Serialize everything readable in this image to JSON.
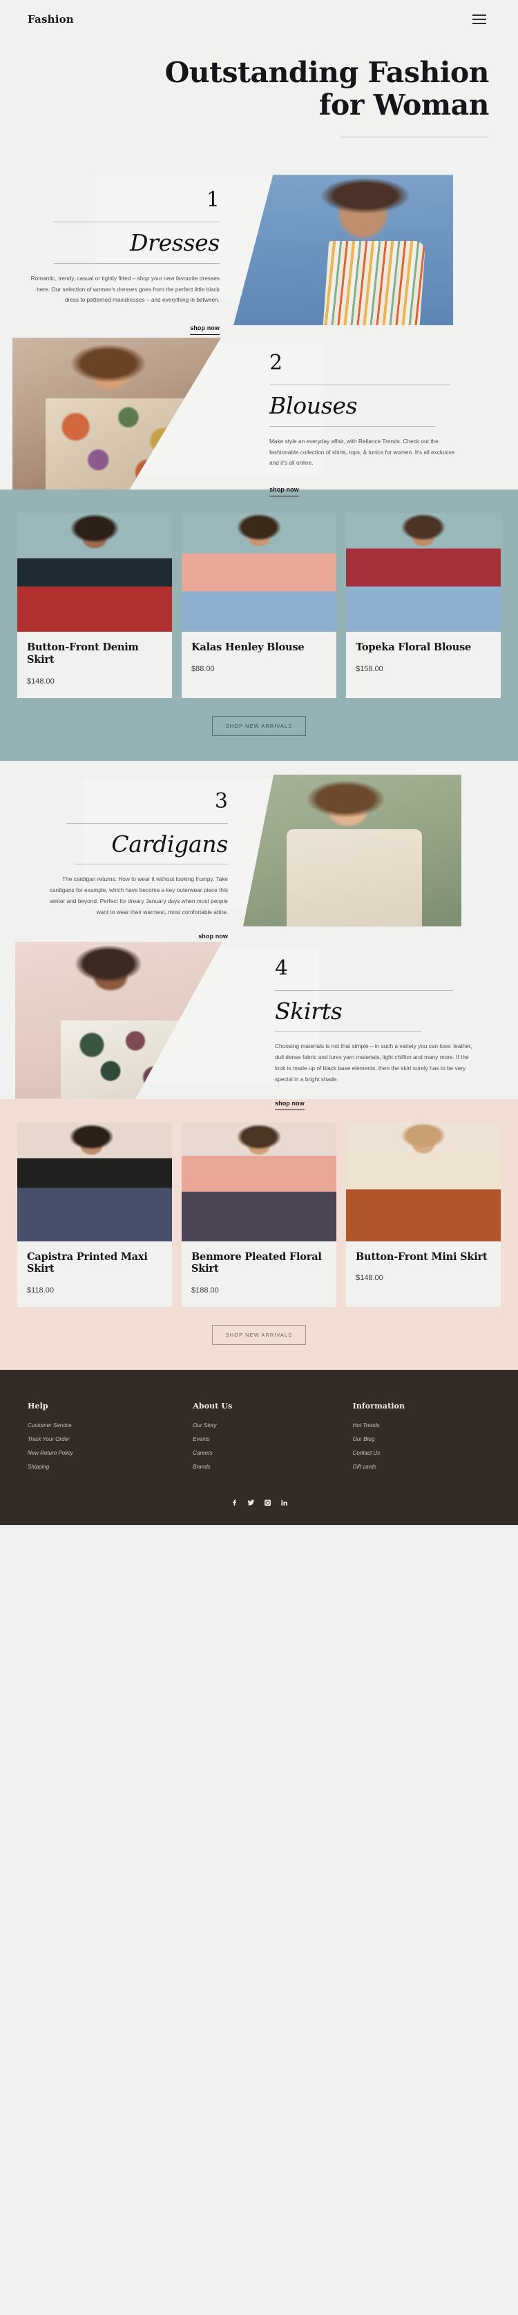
{
  "header": {
    "logo": "Fashion",
    "menu_icon": "hamburger-menu-icon"
  },
  "hero": {
    "title_line1": "Outstanding Fashion",
    "title_line2": "for Woman"
  },
  "sections": [
    {
      "number": "1",
      "title": "Dresses",
      "body": "Romantic, trendy, casual or tightly fitted – shop your new favourite dresses here. Our selection of women's dresses goes from the perfect little black dress to patterned maxidresses – and everything in between.",
      "cta": "shop now",
      "align": "right"
    },
    {
      "number": "2",
      "title": "Blouses",
      "body": "Make style an everyday affair, with Reliance Trends. Check out the fashionable collection of shirts, tops, & tunics for women. It's all exclusive and it's all online.",
      "cta": "shop now",
      "align": "left"
    },
    {
      "number": "3",
      "title": "Cardigans",
      "body": "The cardigan returns: How to wear it without looking frumpy. Take cardigans for example, which have become a key outerwear piece this winter and beyond. Perfect for dreary January days when most people want to wear their warmest, most comfortable attire.",
      "cta": "shop now",
      "align": "right"
    },
    {
      "number": "4",
      "title": "Skirts",
      "body": "Choosing materials is not that simple – in such a variety you can lose: leather, dull dense fabric and lurex yarn materials, light chiffon and many more. If the look is made up of black base elements, then the skirt surely has to be very special in a bright shade.",
      "cta": "shop now",
      "align": "left"
    }
  ],
  "band_teal": {
    "background_color": "#95b3b5",
    "products": [
      {
        "name": "Button-Front Denim Skirt",
        "price": "$148.00"
      },
      {
        "name": "Kalas Henley Blouse",
        "price": "$88.00"
      },
      {
        "name": "Topeka Floral Blouse",
        "price": "$158.00"
      }
    ],
    "cta": "SHOP NEW ARRIVALS"
  },
  "band_pink": {
    "background_color": "#f2ded4",
    "products": [
      {
        "name": "Capistra Printed Maxi Skirt",
        "price": "$118.00"
      },
      {
        "name": "Benmore Pleated Floral Skirt",
        "price": "$188.00"
      },
      {
        "name": "Button-Front Mini Skirt",
        "price": "$148.00"
      }
    ],
    "cta": "SHOP NEW ARRIVALS"
  },
  "footer": {
    "background_color": "#342b27",
    "columns": [
      {
        "heading": "Help",
        "links": [
          "Customer Service",
          "Track Your Order",
          "New Return Policy",
          "Shipping"
        ]
      },
      {
        "heading": "About Us",
        "links": [
          "Our Story",
          "Events",
          "Careers",
          "Brands"
        ]
      },
      {
        "heading": "Information",
        "links": [
          "Hot Trends",
          "Our Blog",
          "Contact Us",
          "Gift cards"
        ]
      }
    ],
    "social": [
      "facebook-icon",
      "twitter-icon",
      "instagram-icon",
      "linkedin-icon"
    ]
  }
}
